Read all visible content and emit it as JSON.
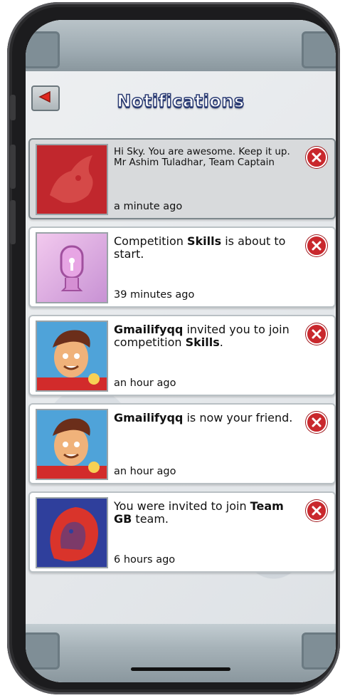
{
  "header": {
    "title": "Notifications"
  },
  "notifications": [
    {
      "icon": "rhino-icon",
      "message": "Hi Sky. You are awesome. Keep it up.\nMr Ashim Tuladhar, Team Captain",
      "time": "a minute ago",
      "thumb_color": "#c1272d",
      "highlighted": true
    },
    {
      "icon": "lock-icon",
      "message_parts": [
        "Competition ",
        "Skills",
        " is about to start."
      ],
      "time": "39 minutes ago",
      "thumb_color": "#e6b3e0"
    },
    {
      "icon": "avatar-icon",
      "message_parts": [
        "Gmailifyqq",
        " invited you to join competition ",
        "Skills",
        "."
      ],
      "time": "an hour ago",
      "thumb_color": "#4fa3d9"
    },
    {
      "icon": "avatar-icon",
      "message_parts": [
        "Gmailifyqq",
        " is now your friend."
      ],
      "time": "an hour ago",
      "thumb_color": "#4fa3d9"
    },
    {
      "icon": "lion-icon",
      "message_parts": [
        "You were invited to join ",
        "Team GB",
        " team."
      ],
      "time": "6 hours ago",
      "thumb_color": "#2f3f9c"
    }
  ]
}
